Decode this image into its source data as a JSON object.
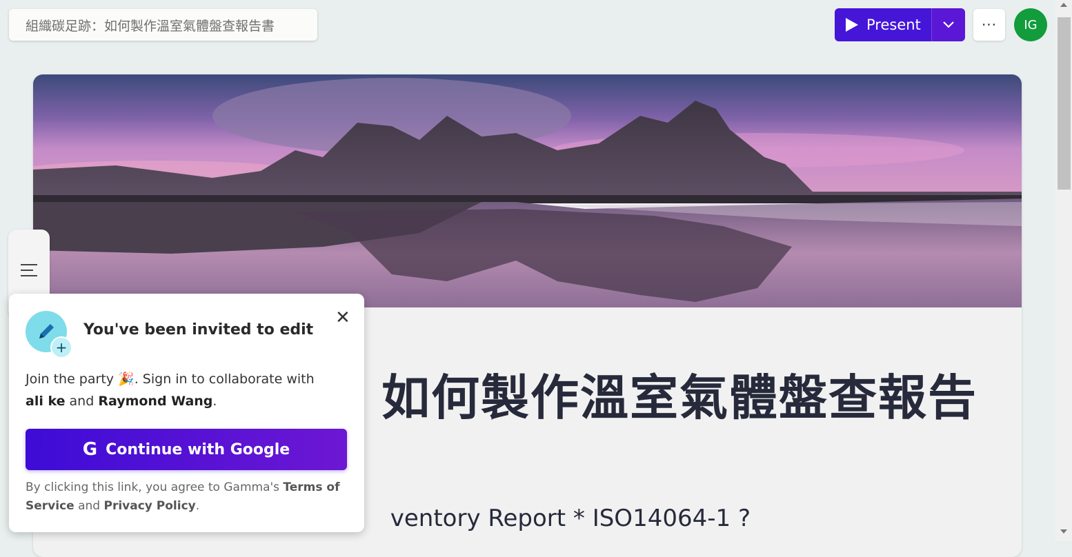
{
  "header": {
    "doc_title": "組織碳足跡：如何製作溫室氣體盤查報告書",
    "present_label": "Present",
    "more_label": "···",
    "avatar_initials": "IG"
  },
  "slide": {
    "title": "如何製作溫室氣體盤查報告",
    "subtitle_visible": "ventory Report * ISO14064-1 ?"
  },
  "invite_popup": {
    "heading": "You've been invited to edit",
    "body_prefix": "Join the party 🎉. Sign in to collaborate with",
    "collaborator_1": "ali ke",
    "and_text": "and",
    "collaborator_2": "Raymond Wang",
    "period": ".",
    "google_button": "Continue with Google",
    "legal_prefix": "By clicking this link, you agree to Gamma's",
    "terms": "Terms of Service",
    "legal_and": "and",
    "privacy": "Privacy Policy",
    "legal_suffix": "."
  },
  "colors": {
    "present_bg": "#4516d8",
    "avatar_bg": "#129c3c",
    "title_color": "#262a3a"
  }
}
